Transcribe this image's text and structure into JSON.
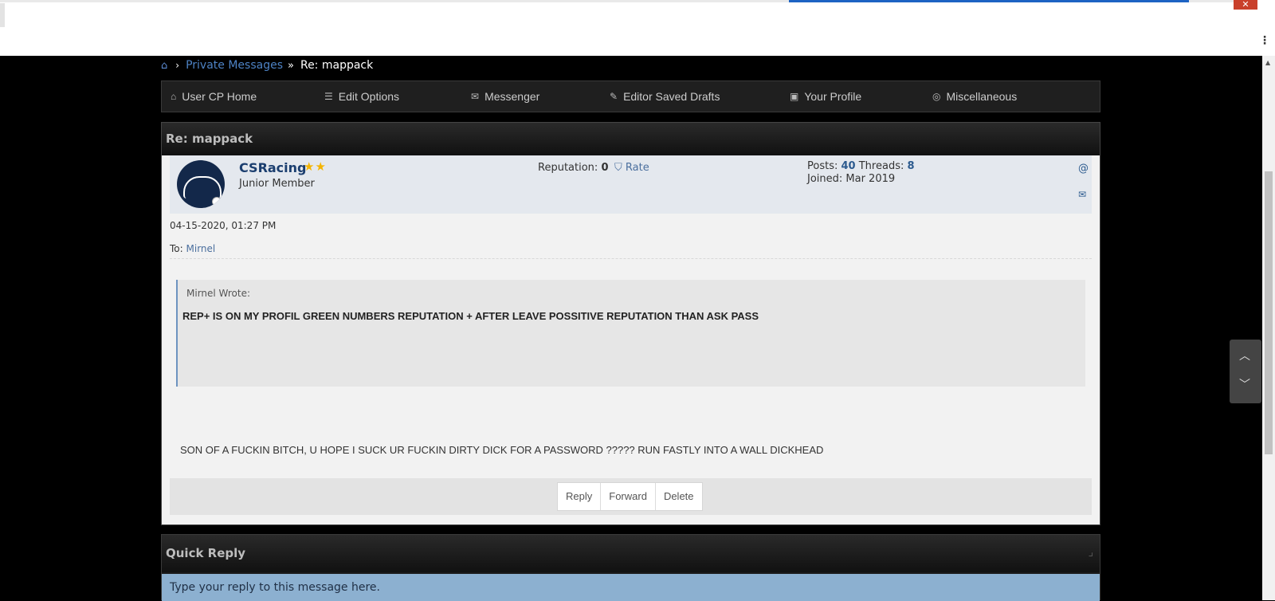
{
  "breadcrumb": {
    "home_icon": "home-icon",
    "link": "Private Messages",
    "current": "Re: mappack"
  },
  "navbar": {
    "items": [
      {
        "label": "User CP Home",
        "icon": "home-outline-icon"
      },
      {
        "label": "Edit Options",
        "icon": "sliders-icon"
      },
      {
        "label": "Messenger",
        "icon": "envelope-icon"
      },
      {
        "label": "Editor Saved Drafts",
        "icon": "edit-square-icon"
      },
      {
        "label": "Your Profile",
        "icon": "profile-card-icon"
      },
      {
        "label": "Miscellaneous",
        "icon": "target-icon"
      }
    ]
  },
  "pm": {
    "title": "Re: mappack",
    "author": {
      "name": "CSRacing",
      "stars": "★★",
      "title": "Junior Member",
      "reputation_label": "Reputation:",
      "reputation_value": "0",
      "rate_label": "Rate",
      "posts_label": "Posts:",
      "posts_value": "40",
      "threads_label": "Threads:",
      "threads_value": "8",
      "joined": "Joined: Mar 2019"
    },
    "date": "04-15-2020, 01:27 PM",
    "to_label": "To:",
    "to_user": "Mirnel",
    "quote": {
      "author": "Mirnel Wrote:",
      "text": "REP+ IS ON MY PROFIL GREEN NUMBERS REPUTATION + AFTER LEAVE POSSITIVE REPUTATION THAN ASK PASS"
    },
    "message": "SON OF A FUCKIN BITCH, U HOPE I SUCK UR FUCKIN DIRTY DICK FOR A PASSWORD ????? RUN FASTLY INTO A WALL DICKHEAD",
    "actions": {
      "reply": "Reply",
      "forward": "Forward",
      "delete": "Delete"
    }
  },
  "quick_reply": {
    "title": "Quick Reply",
    "placeholder": "Type your reply to this message here."
  },
  "colors": {
    "link": "#4d82c4",
    "username": "#1b3e6f",
    "quick_reply_bg": "#8cb0d0",
    "star": "#f4b400"
  }
}
